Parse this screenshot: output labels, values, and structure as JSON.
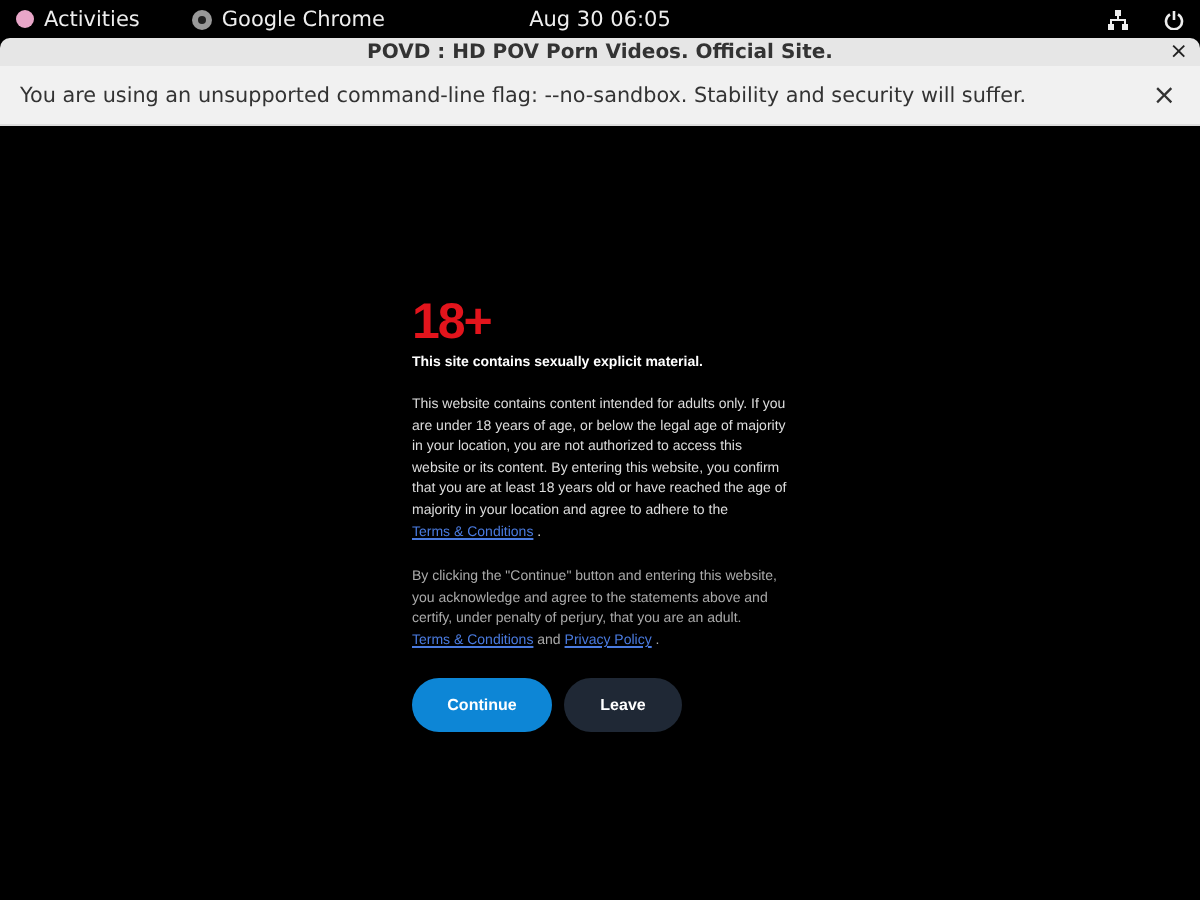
{
  "top_bar": {
    "activities": "Activities",
    "app": "Google Chrome",
    "clock": "Aug 30  06:05"
  },
  "window": {
    "title": "POVD : HD POV Porn Videos. Official Site.",
    "close": "×"
  },
  "infobar": {
    "message": "You are using an unsupported command-line flag: --no-sandbox. Stability and security will suffer.",
    "close": "×"
  },
  "age_gate": {
    "badge": "18+",
    "headline": "This site contains sexually explicit material.",
    "paragraphs": [
      [
        {
          "kind": "text",
          "text": "This website contains content intended for adults only. If you are under 18 years of age, or below the legal age of majority in your location, you are not authorized to access this website or its content. By entering this website, you confirm that you are at least 18 years old or have reached the age of majority in your location and agree to adhere to the "
        },
        {
          "kind": "link",
          "text": "Terms & Conditions"
        },
        {
          "kind": "text",
          "text": " ."
        }
      ],
      [
        {
          "kind": "text",
          "text": "By clicking the \"Continue\" button and entering this website, you acknowledge and agree to the statements above and certify, under penalty of perjury, that you are an adult. "
        },
        {
          "kind": "link",
          "text": "Terms & Conditions"
        },
        {
          "kind": "text",
          "text": " and "
        },
        {
          "kind": "link",
          "text": "Privacy Policy"
        },
        {
          "kind": "text",
          "text": " ."
        }
      ]
    ],
    "buttons": [
      {
        "label": "Continue",
        "kind": "primary"
      },
      {
        "label": "Leave",
        "kind": "secondary"
      }
    ]
  }
}
